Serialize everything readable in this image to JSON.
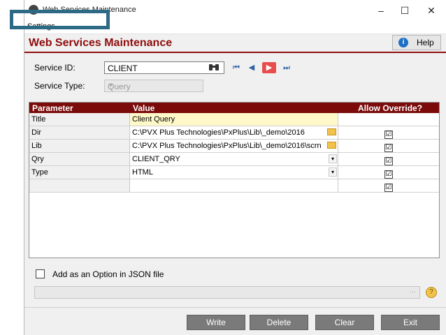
{
  "window": {
    "title": "Web Services Maintenance",
    "minimize": "–",
    "maximize": "☐",
    "close": "✕"
  },
  "menu": {
    "settings": "Settings"
  },
  "header": {
    "title": "Web Services Maintenance",
    "help": "Help",
    "help_icon": "i"
  },
  "form": {
    "service_id_label": "Service ID:",
    "service_id_value": "CLIENT",
    "service_type_label": "Service Type:",
    "service_type_value": "Query",
    "nav": {
      "first": "⏮",
      "prev": "◀",
      "next": "▶",
      "last": "⏭"
    }
  },
  "grid": {
    "headers": {
      "parameter": "Parameter",
      "value": "Value",
      "allow_override": "Allow Override?"
    },
    "rows": [
      {
        "parameter": "Title",
        "value": "Client Query",
        "check": ""
      },
      {
        "parameter": "Dir",
        "value": "C:\\PVX Plus Technologies\\PxPlus\\Lib\\_demo\\2016",
        "check": "☑"
      },
      {
        "parameter": "Lib",
        "value": "C:\\PVX Plus Technologies\\PxPlus\\Lib\\_demo\\2016\\scrn",
        "check": "☑"
      },
      {
        "parameter": "Qry",
        "value": "CLIENT_QRY",
        "check": "☑"
      },
      {
        "parameter": "Type",
        "value": "HTML",
        "check": "☑"
      },
      {
        "parameter": "",
        "value": "",
        "check": "☑"
      }
    ]
  },
  "option": {
    "json_label": "Add as an Option in JSON file"
  },
  "buttons": {
    "write": "Write",
    "delete": "Delete",
    "clear": "Clear",
    "exit": "Exit"
  },
  "colors": {
    "accent": "#8e0d0d",
    "grid_header": "#7b0b0b",
    "highlight_frame": "#2d6a86",
    "title_row_bg": "#fff9c9"
  },
  "icons": [
    "app-icon",
    "help-icon",
    "binoculars-icon",
    "first-record-icon",
    "prev-record-icon",
    "next-record-icon",
    "last-record-icon",
    "folder-icon",
    "dropdown-icon",
    "checkbox-icon",
    "note-icon"
  ]
}
